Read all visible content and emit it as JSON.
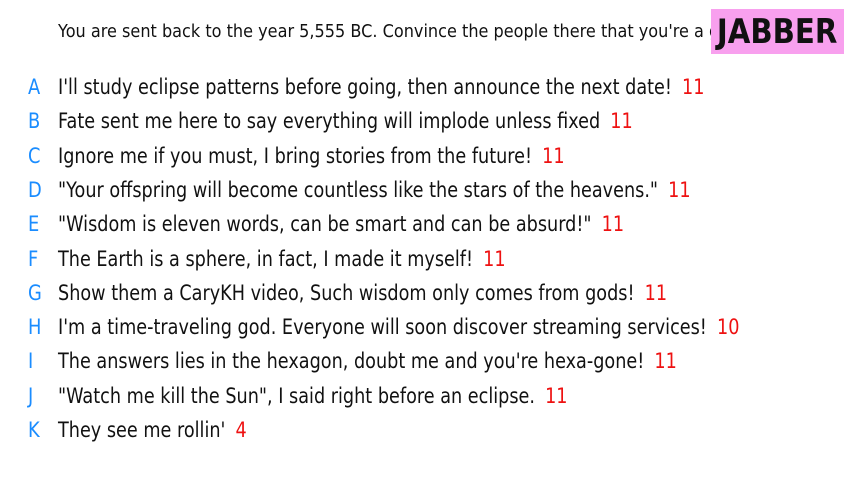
{
  "prompt": "You are sent back to the year 5,555 BC. Convince the people there that you're a god.",
  "logo": "JABBER",
  "colors": {
    "letter": "#1a8cff",
    "score": "#ee1111",
    "logo_bg": "#f8a0ee"
  },
  "answers": [
    {
      "letter": "A",
      "text": "I'll study eclipse patterns before going, then announce the next date!",
      "score": "11"
    },
    {
      "letter": "B",
      "text": "Fate sent me here to say everything will implode unless fixed",
      "score": "11"
    },
    {
      "letter": "C",
      "text": "Ignore me if you must, I bring stories from the future!",
      "score": "11"
    },
    {
      "letter": "D",
      "text": "\"Your offspring will become countless like the stars of the heavens.\"",
      "score": "11"
    },
    {
      "letter": "E",
      "text": "\"Wisdom is eleven words, can be smart and can be absurd!\"",
      "score": "11"
    },
    {
      "letter": "F",
      "text": "The Earth is a sphere, in fact, I made it myself!",
      "score": "11"
    },
    {
      "letter": "G",
      "text": "Show them a CaryKH video, Such wisdom only comes from gods!",
      "score": "11"
    },
    {
      "letter": "H",
      "text": "I'm a time-traveling god. Everyone will soon discover streaming services!",
      "score": "10"
    },
    {
      "letter": "I",
      "text": "The answers lies in the hexagon, doubt me and you're hexa-gone!",
      "score": "11"
    },
    {
      "letter": "J",
      "text": "\"Watch me kill the Sun\", I said right before an eclipse.",
      "score": "11"
    },
    {
      "letter": "K",
      "text": "They see me rollin'",
      "score": "4"
    }
  ]
}
